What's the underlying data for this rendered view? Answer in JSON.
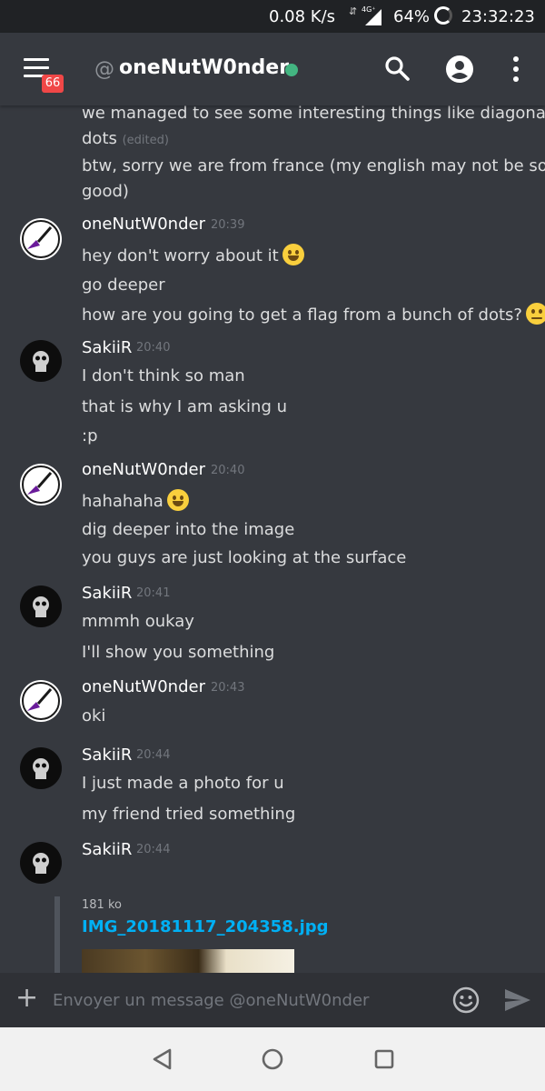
{
  "status_bar": {
    "speed": "0.08 K/s",
    "arrows": "⇵",
    "network": "4G⁺",
    "battery": "64%",
    "time": "23:32:23"
  },
  "header": {
    "unread_badge": "66",
    "at_symbol": "@",
    "title": "oneNutW0nder"
  },
  "messages": [
    {
      "kind": "continuation",
      "text": "we managed to see some interesting things like diagonal"
    },
    {
      "kind": "continuation",
      "text": "dots",
      "edited": "(edited)"
    },
    {
      "kind": "continuation",
      "text": "btw, sorry we are from france (my english may not be so"
    },
    {
      "kind": "continuation",
      "text": "good)"
    },
    {
      "author": "oneNutW0nder",
      "time": "20:39"
    },
    {
      "text": "hey don't worry about it",
      "emoji": "grinning-face"
    },
    {
      "text": "go deeper"
    },
    {
      "text": "how are you going to get a flag from a bunch of dots?",
      "emoji": "thinking-face"
    },
    {
      "author": "SakiiR",
      "time": "20:40"
    },
    {
      "text": "I don't think so man"
    },
    {
      "text": "that is why I am asking u"
    },
    {
      "text": ":p"
    },
    {
      "author": "oneNutW0nder",
      "time": "20:40"
    },
    {
      "text": "hahahaha",
      "emoji": "smiley-face"
    },
    {
      "text": "dig deeper into the image"
    },
    {
      "text": "you guys are just looking at the surface"
    },
    {
      "author": "SakiiR",
      "time": "20:41"
    },
    {
      "text": "mmmh oukay"
    },
    {
      "text": "I'll show you something"
    },
    {
      "author": "oneNutW0nder",
      "time": "20:43"
    },
    {
      "text": "oki"
    },
    {
      "author": "SakiiR",
      "time": "20:44"
    },
    {
      "text": "I just made a photo for u"
    },
    {
      "text": "my friend tried something"
    },
    {
      "author": "SakiiR",
      "time": "20:44"
    }
  ],
  "attachment": {
    "size": "181 ko",
    "filename": "IMG_20181117_204358.jpg"
  },
  "composer": {
    "plus": "+",
    "placeholder": "Envoyer un message @oneNutW0nder"
  },
  "colors": {
    "background": "#36393f",
    "header_bg": "#36393f",
    "link": "#00b0f4",
    "online": "#43b581",
    "badge": "#f04747",
    "composer_bg": "#2f3136"
  }
}
